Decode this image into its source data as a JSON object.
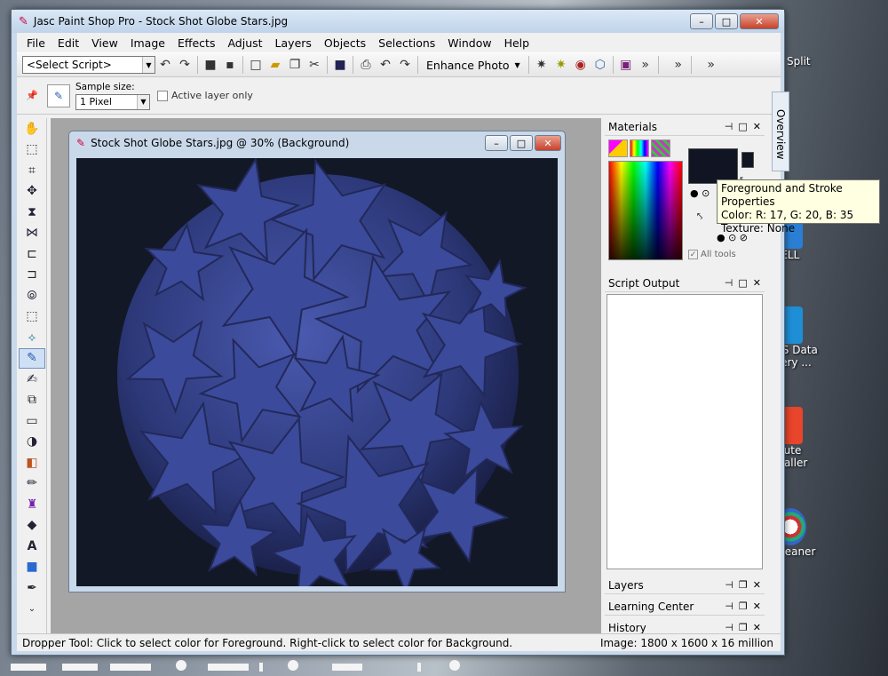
{
  "window": {
    "title": "Jasc Paint Shop Pro - Stock Shot Globe Stars.jpg",
    "min": "–",
    "max": "□",
    "close": "✕"
  },
  "menu": [
    "File",
    "Edit",
    "View",
    "Image",
    "Effects",
    "Adjust",
    "Layers",
    "Objects",
    "Selections",
    "Window",
    "Help"
  ],
  "toolbar": {
    "script_combo": "<Select Script>",
    "enhance_photo": "Enhance Photo",
    "overflow": "»"
  },
  "tool_options": {
    "sample_label": "Sample size:",
    "sample_value": "1 Pixel",
    "active_layer_label": "Active layer only"
  },
  "document": {
    "title": "Stock Shot Globe Stars.jpg @  30% (Background)",
    "bg_color": "#121826",
    "star_color": "#3b4a9a"
  },
  "panels": {
    "materials": "Materials",
    "all_tools": "All tools",
    "script_output": "Script Output",
    "layers": "Layers",
    "learning_center": "Learning Center",
    "history": "History"
  },
  "overview_tab": "Overview",
  "tooltip": {
    "line1": "Foreground and Stroke Properties",
    "line2": "Color: R: 17, G: 20, B: 35",
    "line3": "Texture: None"
  },
  "status": {
    "left": "Dropper Tool: Click to select color for Foreground. Right-click to select color for Background.",
    "right": "Image:  1800 x 1600 x 16 million"
  },
  "desktop": {
    "split": "Split",
    "tell": "TELL",
    "data_recovery": [
      "US Data",
      "very ..."
    ],
    "uninstaller": [
      "olute",
      "staller"
    ],
    "cleaner": "Cleaner"
  },
  "fg_color": "#111423"
}
